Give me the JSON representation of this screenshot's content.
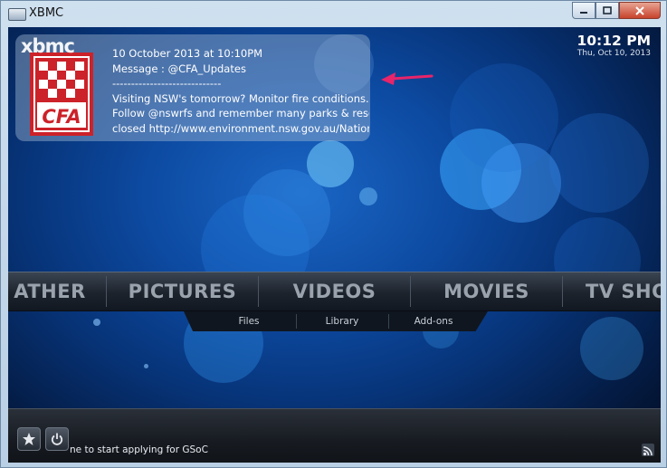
{
  "window": {
    "title": "XBMC",
    "controls": [
      "minimize-icon",
      "maximize-icon",
      "close-icon"
    ]
  },
  "logo": "xbmc",
  "clock": {
    "time": "10:12 PM",
    "date": "Thu, Oct 10, 2013"
  },
  "notification": {
    "icon": "cfa-icon",
    "icon_text": "CFA",
    "lines": [
      "10 October 2013 at 10:10PM",
      "Message : @CFA_Updates",
      "-----------------------------",
      "Visiting NSW's tomorrow? Monitor fire conditions.",
      " Follow @nswrfs and remember many parks & reserves",
      " closed http://www.environment.nsw.gov.au/NationalP"
    ]
  },
  "annotation": {
    "arrow_color": "#e8246a"
  },
  "main_menu": {
    "items": [
      "ATHER",
      "PICTURES",
      "VIDEOS",
      "MOVIES",
      "TV SHO"
    ]
  },
  "submenu": {
    "items": [
      "Files",
      "Library",
      "Add-ons"
    ]
  },
  "footer": {
    "favourites_icon": "star-icon",
    "power_icon": "power-icon",
    "ticker": "ne to start applying for GSoC",
    "rss_icon": "rss-icon"
  },
  "colors": {
    "background": "#0d4ba3",
    "close_button": "#c7432c",
    "cfa_red": "#cc2229"
  }
}
